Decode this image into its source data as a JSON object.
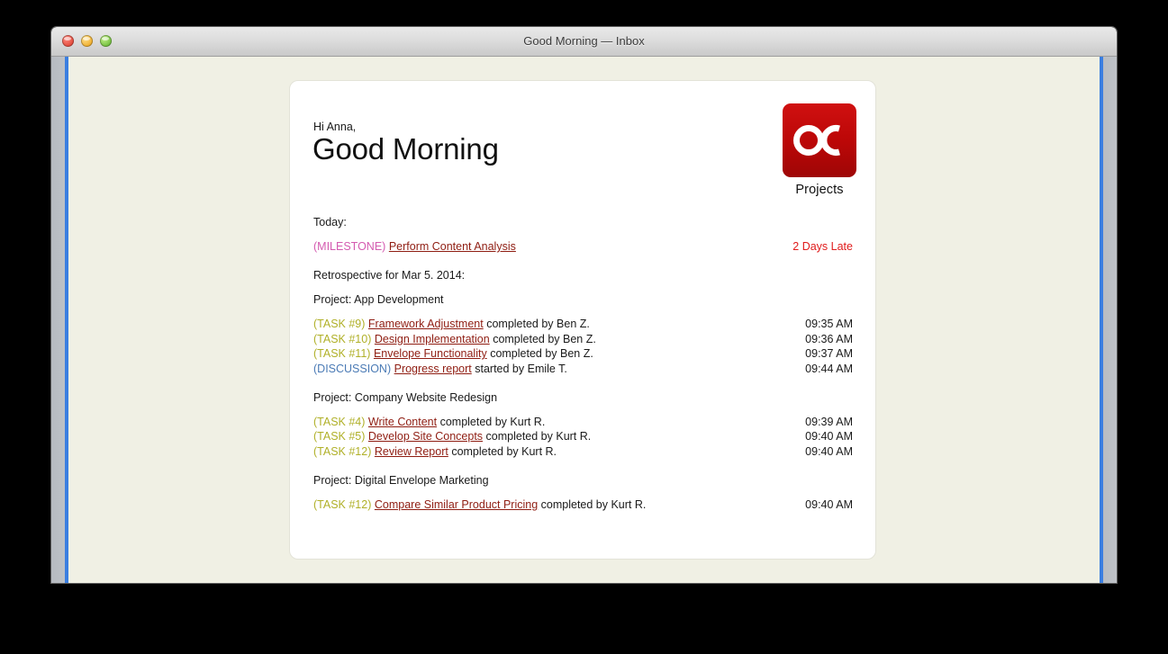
{
  "window": {
    "title": "Good Morning — Inbox",
    "controls": [
      {
        "name": "close",
        "label": "Close"
      },
      {
        "name": "minimize",
        "label": "Minimize"
      },
      {
        "name": "zoom",
        "label": "Zoom"
      }
    ],
    "accent_color": "#3a7ee0"
  },
  "email": {
    "greeting": "Hi Anna,",
    "headline": "Good Morning",
    "logo": {
      "mark_text": "OC",
      "caption": "Projects",
      "color": "#bb0707"
    },
    "today_label": "Today:",
    "today_items": [
      {
        "tag": "(MILESTONE)",
        "tag_type": "milestone",
        "link": "Perform Content Analysis",
        "suffix": "",
        "meta": "2 Days Late",
        "meta_type": "late"
      }
    ],
    "retrospective_label": "Retrospective for Mar 5. 2014:",
    "projects": [
      {
        "title": "Project: App Development",
        "entries": [
          {
            "tag": "(TASK #9)",
            "tag_type": "task",
            "link": "Framework Adjustment",
            "suffix": " completed by Ben Z.",
            "meta": "09:35 AM",
            "meta_type": "time"
          },
          {
            "tag": "(TASK #10)",
            "tag_type": "task",
            "link": "Design Implementation",
            "suffix": " completed by Ben Z.",
            "meta": "09:36 AM",
            "meta_type": "time"
          },
          {
            "tag": "(TASK #11)",
            "tag_type": "task",
            "link": "Envelope Functionality",
            "suffix": " completed by Ben Z.",
            "meta": "09:37 AM",
            "meta_type": "time"
          },
          {
            "tag": "(DISCUSSION)",
            "tag_type": "discussion",
            "link": "Progress report",
            "suffix": " started by Emile T.",
            "meta": "09:44 AM",
            "meta_type": "time"
          }
        ]
      },
      {
        "title": "Project: Company Website Redesign",
        "entries": [
          {
            "tag": "(TASK #4)",
            "tag_type": "task",
            "link": "Write Content",
            "suffix": " completed by Kurt R.",
            "meta": "09:39 AM",
            "meta_type": "time"
          },
          {
            "tag": "(TASK #5)",
            "tag_type": "task",
            "link": "Develop Site Concepts",
            "suffix": " completed by Kurt R.",
            "meta": "09:40 AM",
            "meta_type": "time"
          },
          {
            "tag": "(TASK #12)",
            "tag_type": "task",
            "link": "Review Report",
            "suffix": " completed by Kurt R.",
            "meta": "09:40 AM",
            "meta_type": "time"
          }
        ]
      },
      {
        "title": "Project: Digital Envelope Marketing",
        "entries": [
          {
            "tag": "(TASK #12)",
            "tag_type": "task",
            "link": "Compare Similar Product Pricing",
            "suffix": " completed by Kurt R.",
            "meta": "09:40 AM",
            "meta_type": "time"
          }
        ]
      }
    ]
  }
}
